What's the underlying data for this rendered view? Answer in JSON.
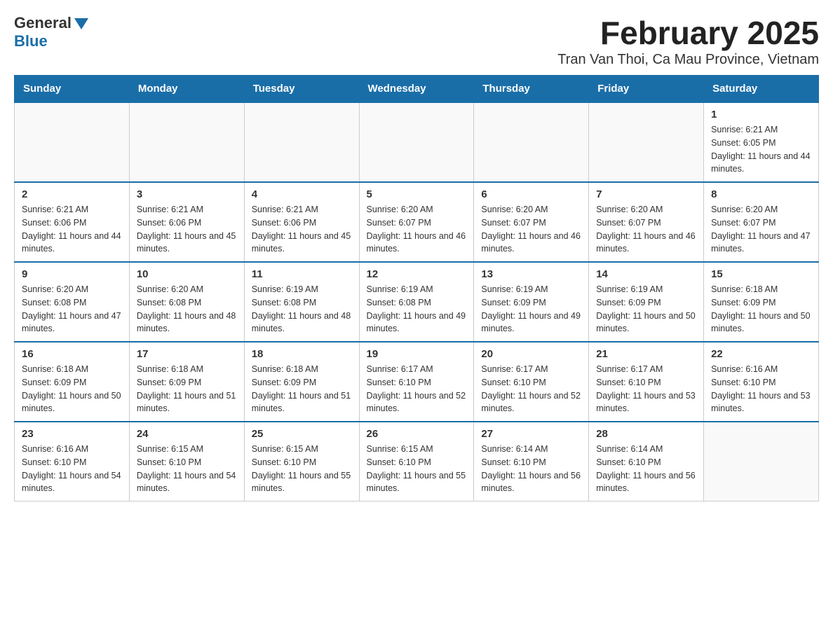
{
  "header": {
    "logo_general": "General",
    "logo_blue": "Blue",
    "title": "February 2025",
    "subtitle": "Tran Van Thoi, Ca Mau Province, Vietnam"
  },
  "weekdays": [
    "Sunday",
    "Monday",
    "Tuesday",
    "Wednesday",
    "Thursday",
    "Friday",
    "Saturday"
  ],
  "weeks": [
    [
      {
        "day": "",
        "info": ""
      },
      {
        "day": "",
        "info": ""
      },
      {
        "day": "",
        "info": ""
      },
      {
        "day": "",
        "info": ""
      },
      {
        "day": "",
        "info": ""
      },
      {
        "day": "",
        "info": ""
      },
      {
        "day": "1",
        "info": "Sunrise: 6:21 AM\nSunset: 6:05 PM\nDaylight: 11 hours and 44 minutes."
      }
    ],
    [
      {
        "day": "2",
        "info": "Sunrise: 6:21 AM\nSunset: 6:06 PM\nDaylight: 11 hours and 44 minutes."
      },
      {
        "day": "3",
        "info": "Sunrise: 6:21 AM\nSunset: 6:06 PM\nDaylight: 11 hours and 45 minutes."
      },
      {
        "day": "4",
        "info": "Sunrise: 6:21 AM\nSunset: 6:06 PM\nDaylight: 11 hours and 45 minutes."
      },
      {
        "day": "5",
        "info": "Sunrise: 6:20 AM\nSunset: 6:07 PM\nDaylight: 11 hours and 46 minutes."
      },
      {
        "day": "6",
        "info": "Sunrise: 6:20 AM\nSunset: 6:07 PM\nDaylight: 11 hours and 46 minutes."
      },
      {
        "day": "7",
        "info": "Sunrise: 6:20 AM\nSunset: 6:07 PM\nDaylight: 11 hours and 46 minutes."
      },
      {
        "day": "8",
        "info": "Sunrise: 6:20 AM\nSunset: 6:07 PM\nDaylight: 11 hours and 47 minutes."
      }
    ],
    [
      {
        "day": "9",
        "info": "Sunrise: 6:20 AM\nSunset: 6:08 PM\nDaylight: 11 hours and 47 minutes."
      },
      {
        "day": "10",
        "info": "Sunrise: 6:20 AM\nSunset: 6:08 PM\nDaylight: 11 hours and 48 minutes."
      },
      {
        "day": "11",
        "info": "Sunrise: 6:19 AM\nSunset: 6:08 PM\nDaylight: 11 hours and 48 minutes."
      },
      {
        "day": "12",
        "info": "Sunrise: 6:19 AM\nSunset: 6:08 PM\nDaylight: 11 hours and 49 minutes."
      },
      {
        "day": "13",
        "info": "Sunrise: 6:19 AM\nSunset: 6:09 PM\nDaylight: 11 hours and 49 minutes."
      },
      {
        "day": "14",
        "info": "Sunrise: 6:19 AM\nSunset: 6:09 PM\nDaylight: 11 hours and 50 minutes."
      },
      {
        "day": "15",
        "info": "Sunrise: 6:18 AM\nSunset: 6:09 PM\nDaylight: 11 hours and 50 minutes."
      }
    ],
    [
      {
        "day": "16",
        "info": "Sunrise: 6:18 AM\nSunset: 6:09 PM\nDaylight: 11 hours and 50 minutes."
      },
      {
        "day": "17",
        "info": "Sunrise: 6:18 AM\nSunset: 6:09 PM\nDaylight: 11 hours and 51 minutes."
      },
      {
        "day": "18",
        "info": "Sunrise: 6:18 AM\nSunset: 6:09 PM\nDaylight: 11 hours and 51 minutes."
      },
      {
        "day": "19",
        "info": "Sunrise: 6:17 AM\nSunset: 6:10 PM\nDaylight: 11 hours and 52 minutes."
      },
      {
        "day": "20",
        "info": "Sunrise: 6:17 AM\nSunset: 6:10 PM\nDaylight: 11 hours and 52 minutes."
      },
      {
        "day": "21",
        "info": "Sunrise: 6:17 AM\nSunset: 6:10 PM\nDaylight: 11 hours and 53 minutes."
      },
      {
        "day": "22",
        "info": "Sunrise: 6:16 AM\nSunset: 6:10 PM\nDaylight: 11 hours and 53 minutes."
      }
    ],
    [
      {
        "day": "23",
        "info": "Sunrise: 6:16 AM\nSunset: 6:10 PM\nDaylight: 11 hours and 54 minutes."
      },
      {
        "day": "24",
        "info": "Sunrise: 6:15 AM\nSunset: 6:10 PM\nDaylight: 11 hours and 54 minutes."
      },
      {
        "day": "25",
        "info": "Sunrise: 6:15 AM\nSunset: 6:10 PM\nDaylight: 11 hours and 55 minutes."
      },
      {
        "day": "26",
        "info": "Sunrise: 6:15 AM\nSunset: 6:10 PM\nDaylight: 11 hours and 55 minutes."
      },
      {
        "day": "27",
        "info": "Sunrise: 6:14 AM\nSunset: 6:10 PM\nDaylight: 11 hours and 56 minutes."
      },
      {
        "day": "28",
        "info": "Sunrise: 6:14 AM\nSunset: 6:10 PM\nDaylight: 11 hours and 56 minutes."
      },
      {
        "day": "",
        "info": ""
      }
    ]
  ]
}
